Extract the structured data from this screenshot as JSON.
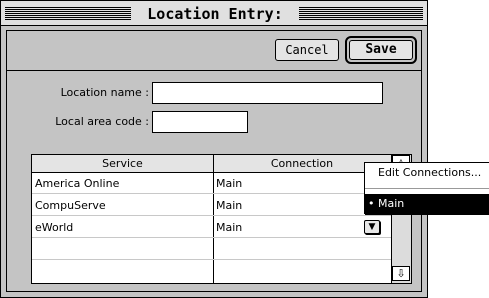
{
  "window": {
    "title": "Location Entry:"
  },
  "toolbar": {
    "cancel_label": "Cancel",
    "save_label": "Save"
  },
  "form": {
    "location_name_label": "Location name :",
    "location_name_value": "",
    "area_code_label": "Local area code :",
    "area_code_value": ""
  },
  "table": {
    "columns": [
      "Service",
      "Connection"
    ],
    "rows": [
      {
        "service": "America Online",
        "connection": "Main"
      },
      {
        "service": "CompuServe",
        "connection": "Main"
      },
      {
        "service": "eWorld",
        "connection": "Main"
      }
    ]
  },
  "popup_menu": {
    "items": [
      {
        "label": "Edit Connections...",
        "selected": false
      },
      {
        "label": "• Main",
        "selected": true
      }
    ]
  },
  "icons": {
    "scroll_up": "scroll-up-arrow-icon",
    "scroll_down": "scroll-down-arrow-icon",
    "popup": "popup-triangle-icon"
  }
}
